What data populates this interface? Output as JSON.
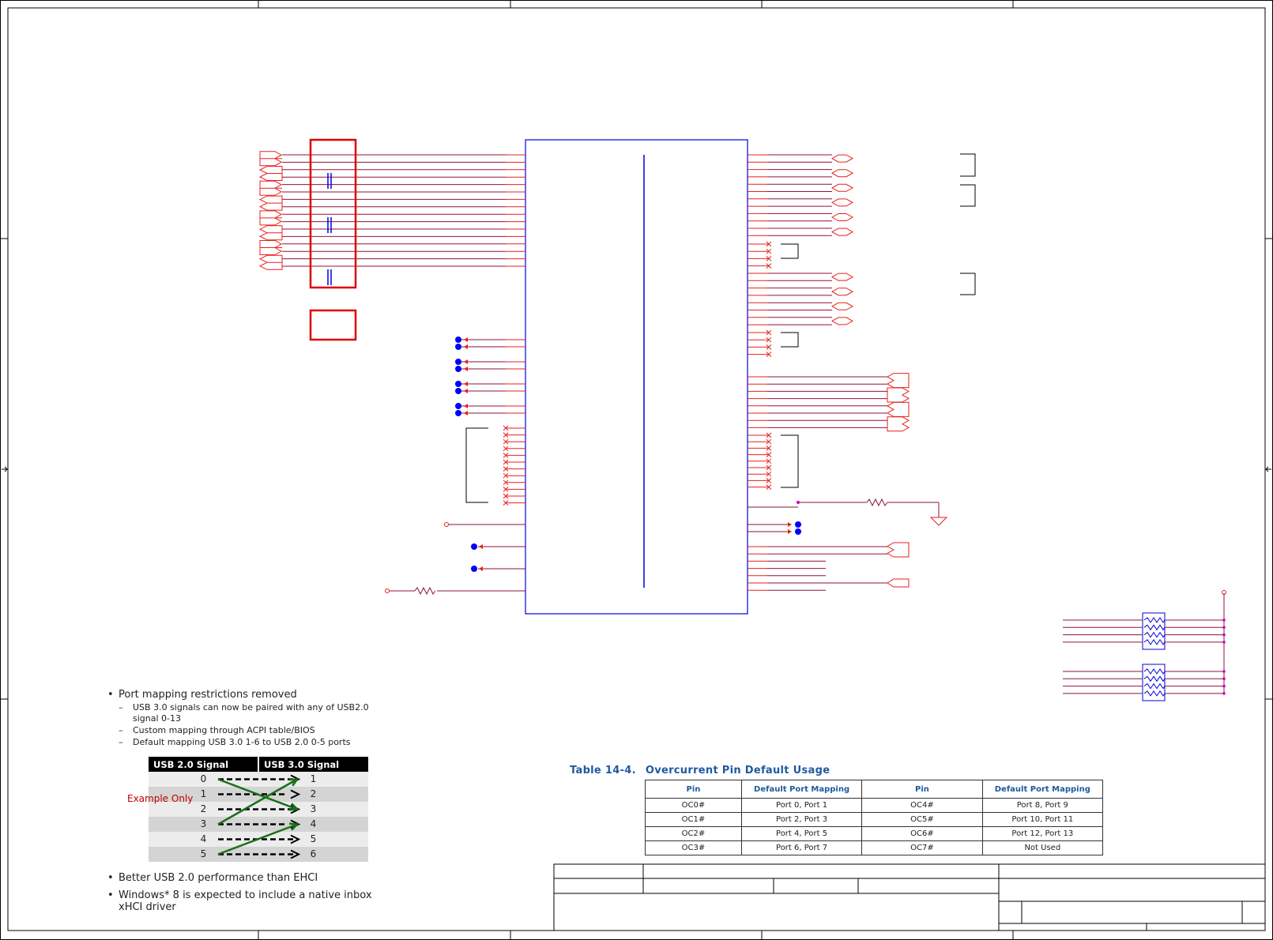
{
  "notes": {
    "bullets_top": [
      {
        "text": "Port mapping restrictions removed",
        "sub": [
          "USB 3.0 signals can now be paired with any of USB2.0 signal 0-13",
          "Custom mapping through ACPI table/BIOS",
          "Default mapping USB 3.0 1-6 to USB 2.0 0-5 ports"
        ]
      }
    ],
    "bullets_bottom": [
      "Better USB 2.0 performance than EHCI",
      "Windows* 8 is expected to include a native inbox xHCI driver"
    ]
  },
  "usb_mapping": {
    "headers": [
      "USB 2.0 Signal",
      "USB 3.0 Signal"
    ],
    "rows": [
      [
        "0",
        "1"
      ],
      [
        "1",
        "2"
      ],
      [
        "2",
        "3"
      ],
      [
        "3",
        "4"
      ],
      [
        "4",
        "5"
      ],
      [
        "5",
        "6"
      ]
    ],
    "example_label": "Example Only",
    "default_arrow_color": "#000000",
    "custom_arrow_color": "#1a6e1a"
  },
  "oc_table": {
    "caption_number": "Table 14-4.",
    "caption_title": "Overcurrent Pin Default Usage",
    "headers": [
      "Pin",
      "Default Port Mapping",
      "Pin",
      "Default Port Mapping"
    ],
    "rows": [
      [
        "OC0#",
        "Port 0, Port 1",
        "OC4#",
        "Port 8, Port 9"
      ],
      [
        "OC1#",
        "Port 2, Port 3",
        "OC5#",
        "Port 10, Port 11"
      ],
      [
        "OC2#",
        "Port 4, Port 5",
        "OC6#",
        "Port 12, Port 13"
      ],
      [
        "OC3#",
        "Port 6, Port 7",
        "OC7#",
        "Not Used"
      ]
    ]
  },
  "colors": {
    "net": "#8b1538",
    "pin": "#e8201c",
    "part": "#0000e0",
    "highlight": "#e00000",
    "junction": "#0000ff",
    "power": "#cc00cc",
    "caption": "#1f5a9e",
    "frame": "#000000"
  }
}
